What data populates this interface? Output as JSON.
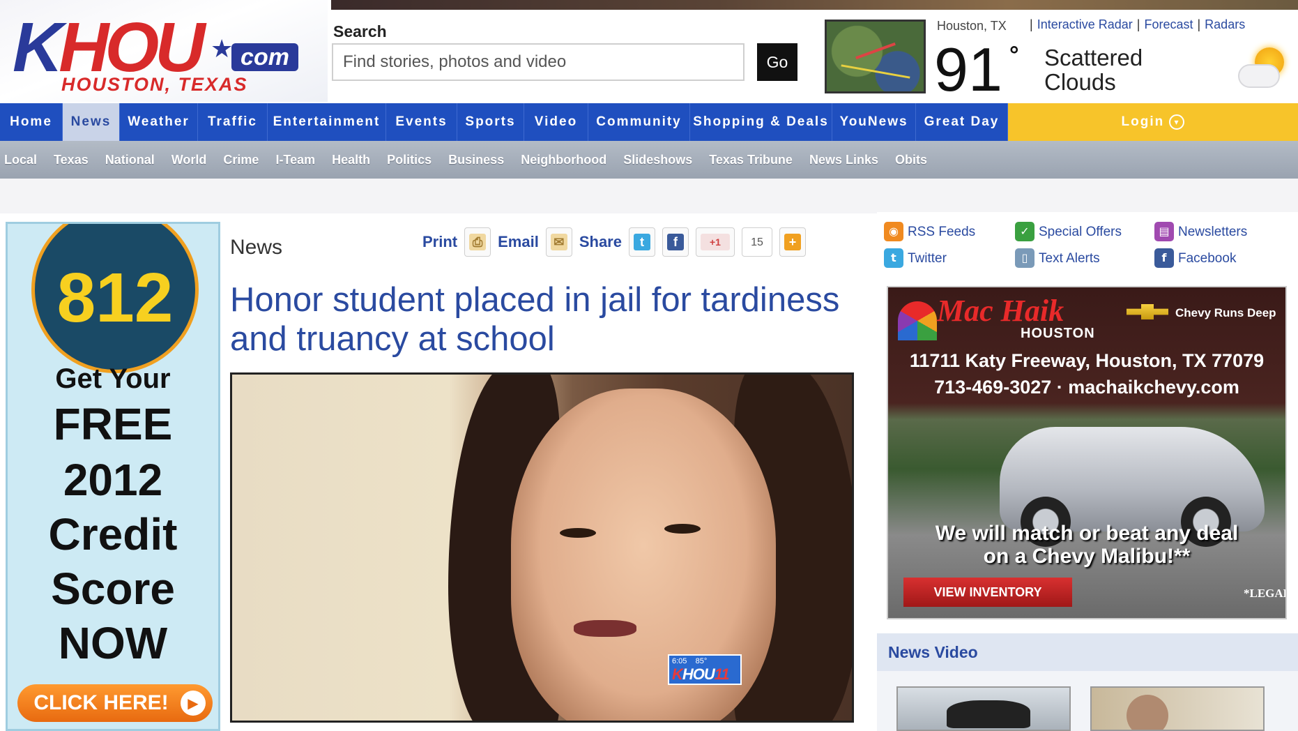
{
  "logo": {
    "brand_k": "K",
    "brand_h": "H",
    "brand_ou": "OU",
    "dotcom": "com",
    "city": "HOUSTON, TEXAS"
  },
  "search": {
    "label": "Search",
    "placeholder": "Find stories, photos and video",
    "go_label": "Go"
  },
  "weather": {
    "city": "Houston, TX",
    "links": [
      "Interactive Radar",
      "Forecast",
      "Radars"
    ],
    "temp": "91",
    "degree": "°",
    "condition": "Scattered Clouds",
    "icon": "partly-cloudy-icon"
  },
  "main_nav": {
    "items": [
      "Home",
      "News",
      "Weather",
      "Traffic",
      "Entertainment",
      "Events",
      "Sports",
      "Video",
      "Community",
      "Shopping & Deals",
      "YouNews",
      "Great Day"
    ],
    "active": "News",
    "login": "Login"
  },
  "sub_nav": {
    "items": [
      "Local",
      "Texas",
      "National",
      "World",
      "Crime",
      "I-Team",
      "Health",
      "Politics",
      "Business",
      "Neighborhood",
      "Slideshows",
      "Texas Tribune",
      "News Links",
      "Obits"
    ]
  },
  "left_ad": {
    "number": "812",
    "lines": [
      "Get Your",
      "FREE",
      "2012",
      "Credit",
      "Score",
      "NOW"
    ],
    "cta": "CLICK HERE!"
  },
  "article": {
    "section": "News",
    "tools": {
      "print": "Print",
      "email": "Email",
      "share": "Share",
      "plus_count": "15",
      "gplus": "+1"
    },
    "headline": "Honor student placed in jail for tardiness and truancy at school",
    "photo_bug": {
      "time": "6:05",
      "temp": "85°",
      "logo_k": "K",
      "logo_rest": "HOU",
      "logo_tail": "11"
    }
  },
  "follow": {
    "items": [
      {
        "label": "RSS Feeds",
        "icon": "rss-icon",
        "color": "#f08a20"
      },
      {
        "label": "Special Offers",
        "icon": "check-icon",
        "color": "#3aa040"
      },
      {
        "label": "Newsletters",
        "icon": "newsletter-icon",
        "color": "#a04ab0"
      },
      {
        "label": "Twitter",
        "icon": "twitter-icon",
        "color": "#3aa8e0"
      },
      {
        "label": "Text Alerts",
        "icon": "phone-icon",
        "color": "#7a9ab8"
      },
      {
        "label": "Facebook",
        "icon": "facebook-icon",
        "color": "#3a5a9a"
      }
    ]
  },
  "car_ad": {
    "brand": "Mac Haik",
    "city": "HOUSTON",
    "slogan": "Chevy Runs Deep",
    "address": "11711 Katy Freeway, Houston, TX 77079",
    "phone": "713-469-3027 · machaikchevy.com",
    "deal_line1": "We will match or beat any deal",
    "deal_line2": "on a Chevy Malibu!**",
    "button": "VIEW INVENTORY",
    "legal": "*LEGAL"
  },
  "news_video": {
    "title": "News Video"
  },
  "colors": {
    "nav_blue": "#1f4fbf",
    "link_blue": "#2a4aa0",
    "login_yellow": "#f7c42a",
    "subnav_gray": "#a3abb8"
  }
}
